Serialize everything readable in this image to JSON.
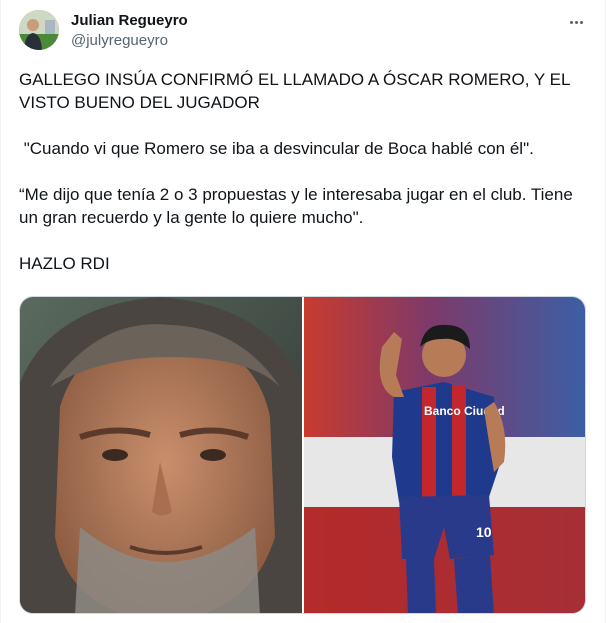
{
  "author": {
    "display_name": "Julian Regueyro",
    "handle": "@julyregueyro"
  },
  "tweet": {
    "paragraphs": [
      "GALLEGO INSÚA CONFIRMÓ EL LLAMADO A ÓSCAR ROMERO, Y EL VISTO BUENO DEL JUGADOR",
      " \"Cuando vi que Romero se iba a desvincular de Boca hablé con él\".",
      "“Me dijo que tenía 2 o 3 propuestas y le interesaba jugar en el club. Tiene un gran recuerdo y la gente lo quiere mucho\".",
      "HAZLO RDI"
    ]
  },
  "media": {
    "shirt_text": "Banco Ciudad",
    "shirt_number": "10"
  },
  "colors": {
    "text": "#0f1419",
    "secondary": "#536471",
    "border": "#cfd9de"
  },
  "icons": [
    "more-options-icon"
  ]
}
